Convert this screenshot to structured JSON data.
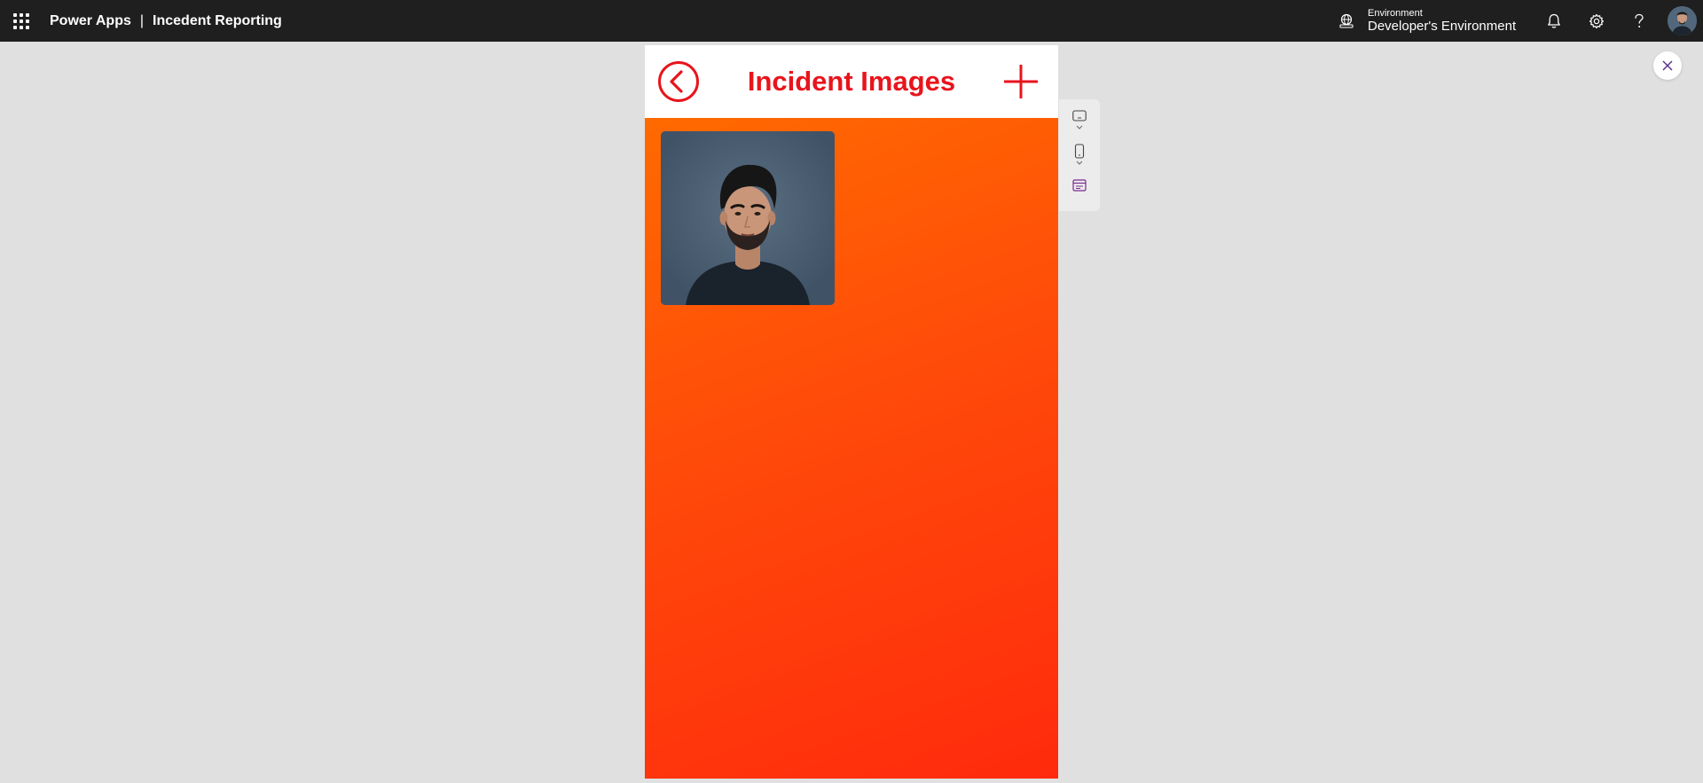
{
  "topbar": {
    "product": "Power Apps",
    "separator": "|",
    "app_name": "Incedent Reporting",
    "environment_label": "Environment",
    "environment_name": "Developer's Environment",
    "icons": [
      "waffle-icon",
      "environment-icon",
      "bell-icon",
      "gear-icon",
      "help-icon",
      "avatar"
    ]
  },
  "phone": {
    "title": "Incident Images",
    "title_color": "#e8141c",
    "back_icon": "chevron-left-circle-icon",
    "add_icon": "plus-icon",
    "gradient": [
      "#ff6a00",
      "#ff2a0c"
    ],
    "gallery": [
      {
        "image": "person-photo"
      }
    ]
  },
  "side_toolbar": {
    "icons": [
      "tablet-landscape-icon",
      "phone-portrait-icon",
      "app-preview-icon"
    ]
  },
  "close_icon": "close-icon"
}
